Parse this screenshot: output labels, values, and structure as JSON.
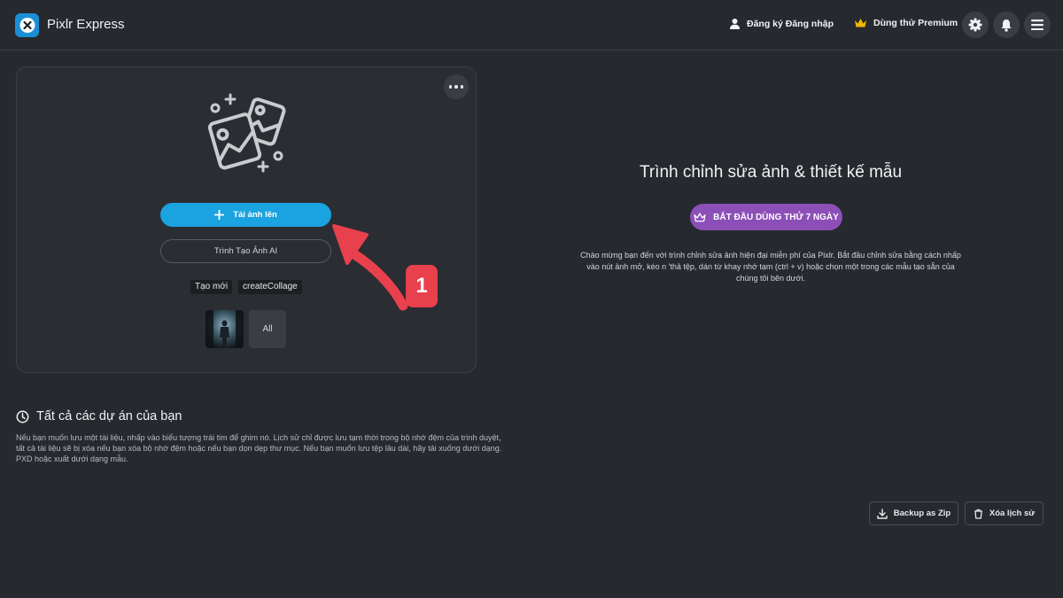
{
  "header": {
    "app_name": "Pixlr Express",
    "auth_label": "Đăng ký Đăng nhập",
    "premium_label": "Dùng thử Premium",
    "icons": [
      "user-icon",
      "crown-icon",
      "gear-icon",
      "bell-icon",
      "menu-icon"
    ]
  },
  "card": {
    "upload_label": "Tải ảnh lên",
    "ai_label": "Trình Tạo Ảnh AI",
    "chips": [
      "Tạo mới",
      "createCollage"
    ],
    "all_label": "All"
  },
  "annotation": {
    "number": "1"
  },
  "intro": {
    "title": "Trình chỉnh sửa ảnh & thiết kế mẫu",
    "trial_label": "BẮT ĐẦU DÙNG THỬ 7 NGÀY",
    "description": "Chào mừng bạn đến với trình chỉnh sửa ảnh hiện đại miễn phí của Pixlr. Bắt đầu chỉnh sửa bằng cách nhấp vào nút ảnh mở, kéo n 'thả tệp, dán từ khay nhớ tạm (ctrl + v) hoặc chọn một trong các mẫu tạo sẵn của chúng tôi bên dưới."
  },
  "projects": {
    "title": "Tất cả các dự án của bạn",
    "description": "Nếu bạn muốn lưu một tài liệu, nhấp vào biểu tượng trái tim để ghim nó. Lịch sử chỉ được lưu tạm thời trong bộ nhớ đệm của trình duyệt, tất cả tài liệu sẽ bị xóa nếu bạn xóa bộ nhớ đệm hoặc nếu bạn dọn dẹp thư mục. Nếu bạn muốn lưu tệp lâu dài, hãy tải xuống dưới dạng. PXD hoặc xuất dưới dạng mẫu.",
    "backup_label": "Backup as Zip",
    "clear_label": "Xóa lịch sử"
  },
  "colors": {
    "background": "#26292e",
    "accent_blue": "#1aa3e0",
    "accent_purple": "#8c4fb8",
    "annotation_red": "#e8404d",
    "crown_gold": "#f5b800"
  }
}
